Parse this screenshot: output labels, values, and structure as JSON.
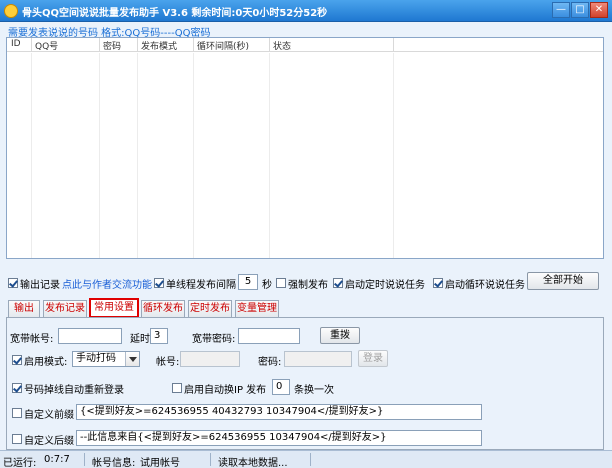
{
  "window": {
    "title": "骨头QQ空间说说批量发布助手 V3.6 剩余时间:0天0小时52分52秒",
    "minimize": "—",
    "maximize": "□",
    "close": "✕"
  },
  "hint": "需要发表说说的号码 格式:QQ号码----QQ密码",
  "table": {
    "columns": [
      "ID",
      "QQ号",
      "密码",
      "发布模式",
      "循环间隔(秒)",
      "状态"
    ]
  },
  "options": {
    "output_log": "输出记录",
    "contact_author": "点此与作者交流功能",
    "single_thread_interval": "单线程发布间隔",
    "interval_value": "5",
    "seconds": "秒",
    "force_publish": "强制发布",
    "enable_timed": "启动定时说说任务",
    "enable_loop": "启动循环说说任务",
    "start_all": "全部开始"
  },
  "tabs": [
    {
      "label": "输出"
    },
    {
      "label": "发布记录"
    },
    {
      "label": "常用设置"
    },
    {
      "label": "循环发布"
    },
    {
      "label": "定时发布"
    },
    {
      "label": "变量管理"
    }
  ],
  "settings": {
    "broadband_account_label": "宽带帐号:",
    "broadband_account_value": "",
    "delay_label": "延时",
    "delay_value": "3",
    "broadband_password_label": "宽带密码:",
    "broadband_password_value": "",
    "redial_button": "重拨",
    "enable_mode_label": "启用模式:",
    "mode_value": "手动打码",
    "account_label": "帐号:",
    "account_value": "",
    "password_label": "密码:",
    "password_value": "",
    "login_button": "登录",
    "auto_relogin": "号码掉线自动重新登录",
    "auto_ip_switch": "启用自动换IP 发布",
    "switch_count": "0",
    "switch_suffix": "条换一次",
    "custom_prefix_label": "自定义前缀",
    "custom_prefix_value": "{<提到好友>=624536955 40432793 10347904</提到好友>}",
    "custom_suffix_label": "自定义后缀",
    "custom_suffix_value": "--此信息来自{<提到好友>=624536955 10347904</提到好友>}"
  },
  "status": {
    "runtime_label": "已运行:",
    "runtime_value": "0:7:7",
    "account_info_label": "帐号信息:",
    "account_info_value": "试用帐号",
    "loading": "读取本地数据..."
  },
  "colors": {
    "accent": "#1f78d1",
    "tab_text": "#cc0000",
    "link": "#1a5fd6"
  }
}
